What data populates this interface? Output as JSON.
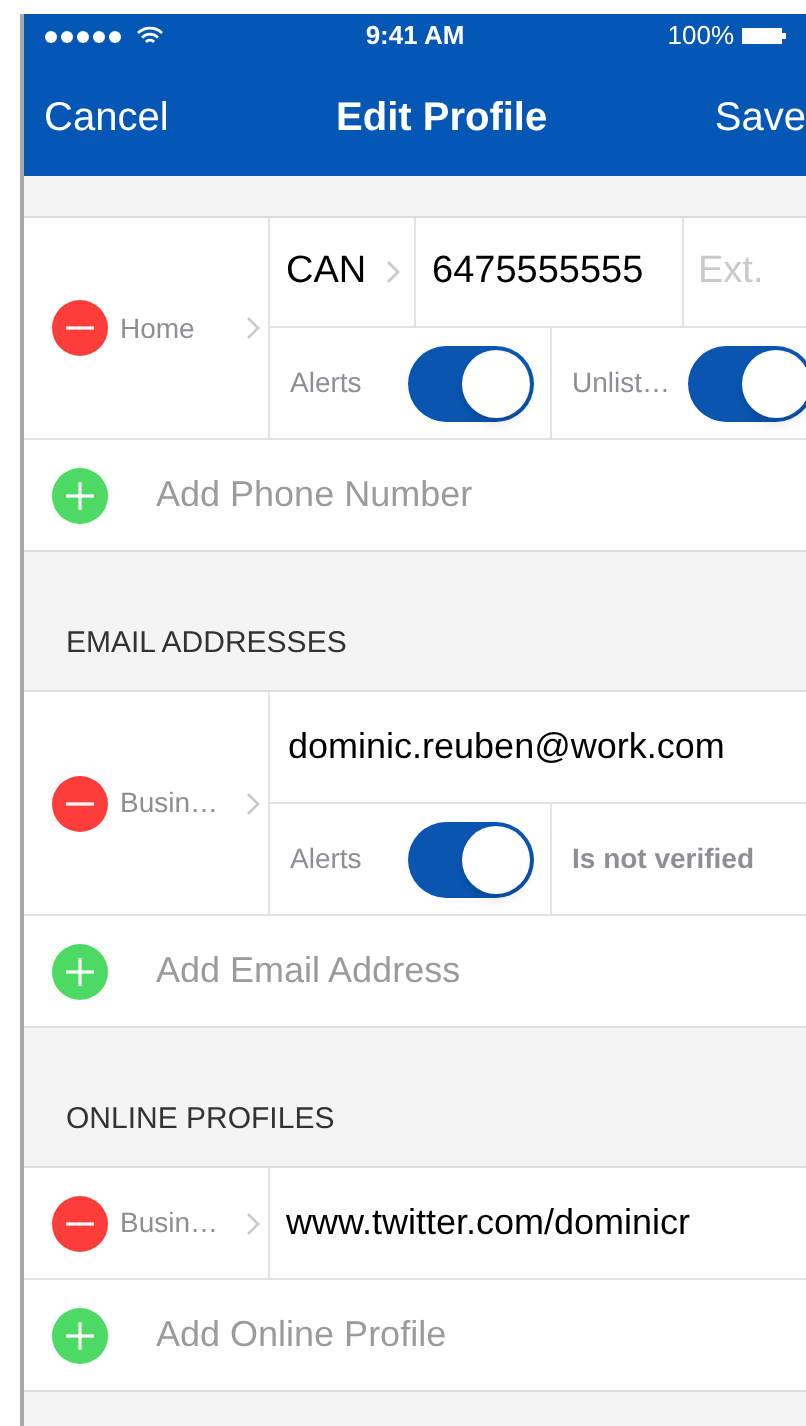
{
  "status_bar": {
    "time": "9:41 AM",
    "battery": "100%"
  },
  "nav_bar": {
    "cancel": "Cancel",
    "title": "Edit Profile",
    "save": "Save"
  },
  "sections": [
    {
      "items": [
        {
          "kind": "phone",
          "label": "Home",
          "country": "CAN",
          "number": "6475555555",
          "ext_placeholder": "Ext.",
          "toggles": [
            {
              "label": "Alerts",
              "on": true
            },
            {
              "label": "Unlist…",
              "on": true
            }
          ]
        }
      ],
      "add_label": "Add Phone Number"
    },
    {
      "header": "EMAIL ADDRESSES",
      "items": [
        {
          "kind": "email",
          "label": "Busin…",
          "value": "dominic.reuben@work.com",
          "toggles": [
            {
              "label": "Alerts",
              "on": true
            }
          ],
          "note": "Is not verified"
        }
      ],
      "add_label": "Add Email Address"
    },
    {
      "header": "ONLINE PROFILES",
      "items": [
        {
          "kind": "url",
          "label": "Busin…",
          "value": "www.twitter.com/dominicr"
        }
      ],
      "add_label": "Add Online Profile"
    }
  ]
}
